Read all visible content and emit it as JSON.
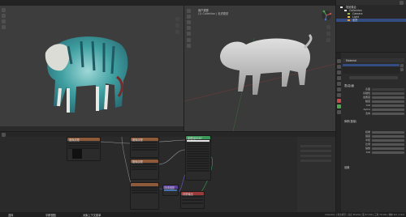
{
  "viewport_right": {
    "view_name": "用户透视",
    "collection_label": "(1) Collection | 老虎模型"
  },
  "outliner": {
    "items": [
      {
        "label": "场景集合"
      },
      {
        "label": "Collection"
      },
      {
        "label": "Camera"
      },
      {
        "label": "Light"
      },
      {
        "label": "老虎"
      }
    ]
  },
  "properties": {
    "material_name": "Material",
    "sections": [
      "表(曲)面",
      "体积(音量)",
      "设置"
    ],
    "surface_rows": [
      {
        "label": "表面"
      },
      {
        "label": "基础色"
      },
      {
        "label": "金属度"
      },
      {
        "label": "糙度"
      },
      {
        "label": "IOR"
      },
      {
        "label": "Alpha"
      },
      {
        "label": "法向"
      }
    ],
    "value_rows": [
      {
        "label": "权重"
      },
      {
        "label": "强度"
      },
      {
        "label": "半径"
      },
      {
        "label": "比例"
      },
      {
        "label": "缩放"
      },
      {
        "label": "IOR"
      }
    ],
    "footer_section": "设置"
  },
  "node_editor": {
    "nodes": [
      {
        "title": "图像纹理"
      },
      {
        "title": "图像纹理"
      },
      {
        "title": "图像纹理"
      },
      {
        "title": "原理化BSDF"
      },
      {
        "title": "法线贴图"
      },
      {
        "title": "材质输出"
      }
    ]
  },
  "statusbar": {
    "left_items": [
      "选择",
      "平移视图",
      "对象上下文菜单"
    ],
    "right_text": "Collection | 老虎模型 | 顶点 38,252 | 面 37,744 | 三角 75,502 | 物体 0/3 | 3.6.0"
  },
  "colors": {
    "texture_header": "#8e5a3a",
    "shader_header": "#3b9a5a",
    "vector_header": "#5d3fa0",
    "output_header": "#9b3a3a",
    "accent": "#4772b3"
  }
}
